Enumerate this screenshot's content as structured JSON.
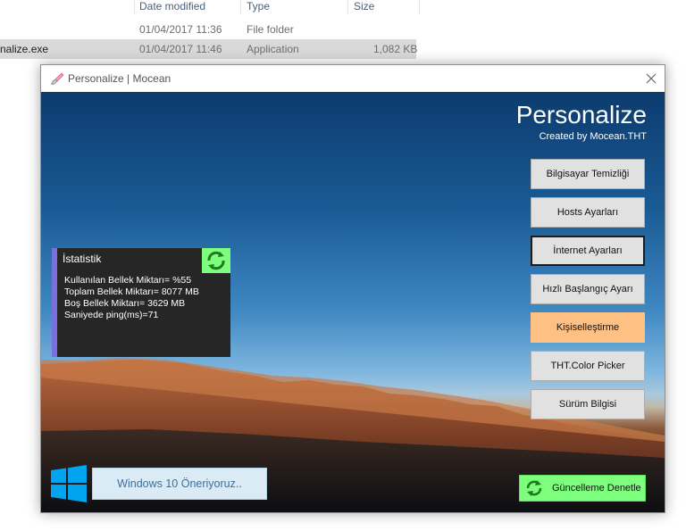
{
  "explorer": {
    "columns": {
      "date_modified": "Date modified",
      "type": "Type",
      "size": "Size"
    },
    "rows": [
      {
        "name": "",
        "date": "01/04/2017 11:36",
        "type": "File folder",
        "size": ""
      },
      {
        "name": "nalize.exe",
        "date": "01/04/2017 11:46",
        "type": "Application",
        "size": "1,082 KB"
      }
    ]
  },
  "window": {
    "title": "Personalize | Mocean"
  },
  "app": {
    "title": "Personalize",
    "subtitle": "Created by Mocean.THT"
  },
  "menu": {
    "items": [
      {
        "label": "Bilgisayar Temizliği"
      },
      {
        "label": "Hosts Ayarları"
      },
      {
        "label": "İnternet Ayarları"
      },
      {
        "label": "Hızlı Başlangıç Ayarı"
      },
      {
        "label": "Kişiselleştirme"
      },
      {
        "label": "THT.Color Picker"
      },
      {
        "label": "Sürüm Bilgisi"
      }
    ]
  },
  "stats": {
    "title": "İstatistik",
    "used_memory": "Kullanılan Bellek Miktarı= %55",
    "total_memory": "Toplam Bellek Miktarı= 8077 MB",
    "free_memory": "Boş Bellek Miktarı= 3629 MB",
    "ping": "Saniyede ping(ms)=71"
  },
  "footer": {
    "recommend_label": "Windows 10 Öneriyoruz..",
    "update_label": "Güncelleme Denetle"
  },
  "colors": {
    "stats_accent": "#7a6fe0",
    "refresh_green": "#7dff7d",
    "active_orange": "#ffc183",
    "windows_blue": "#00a4ef"
  }
}
